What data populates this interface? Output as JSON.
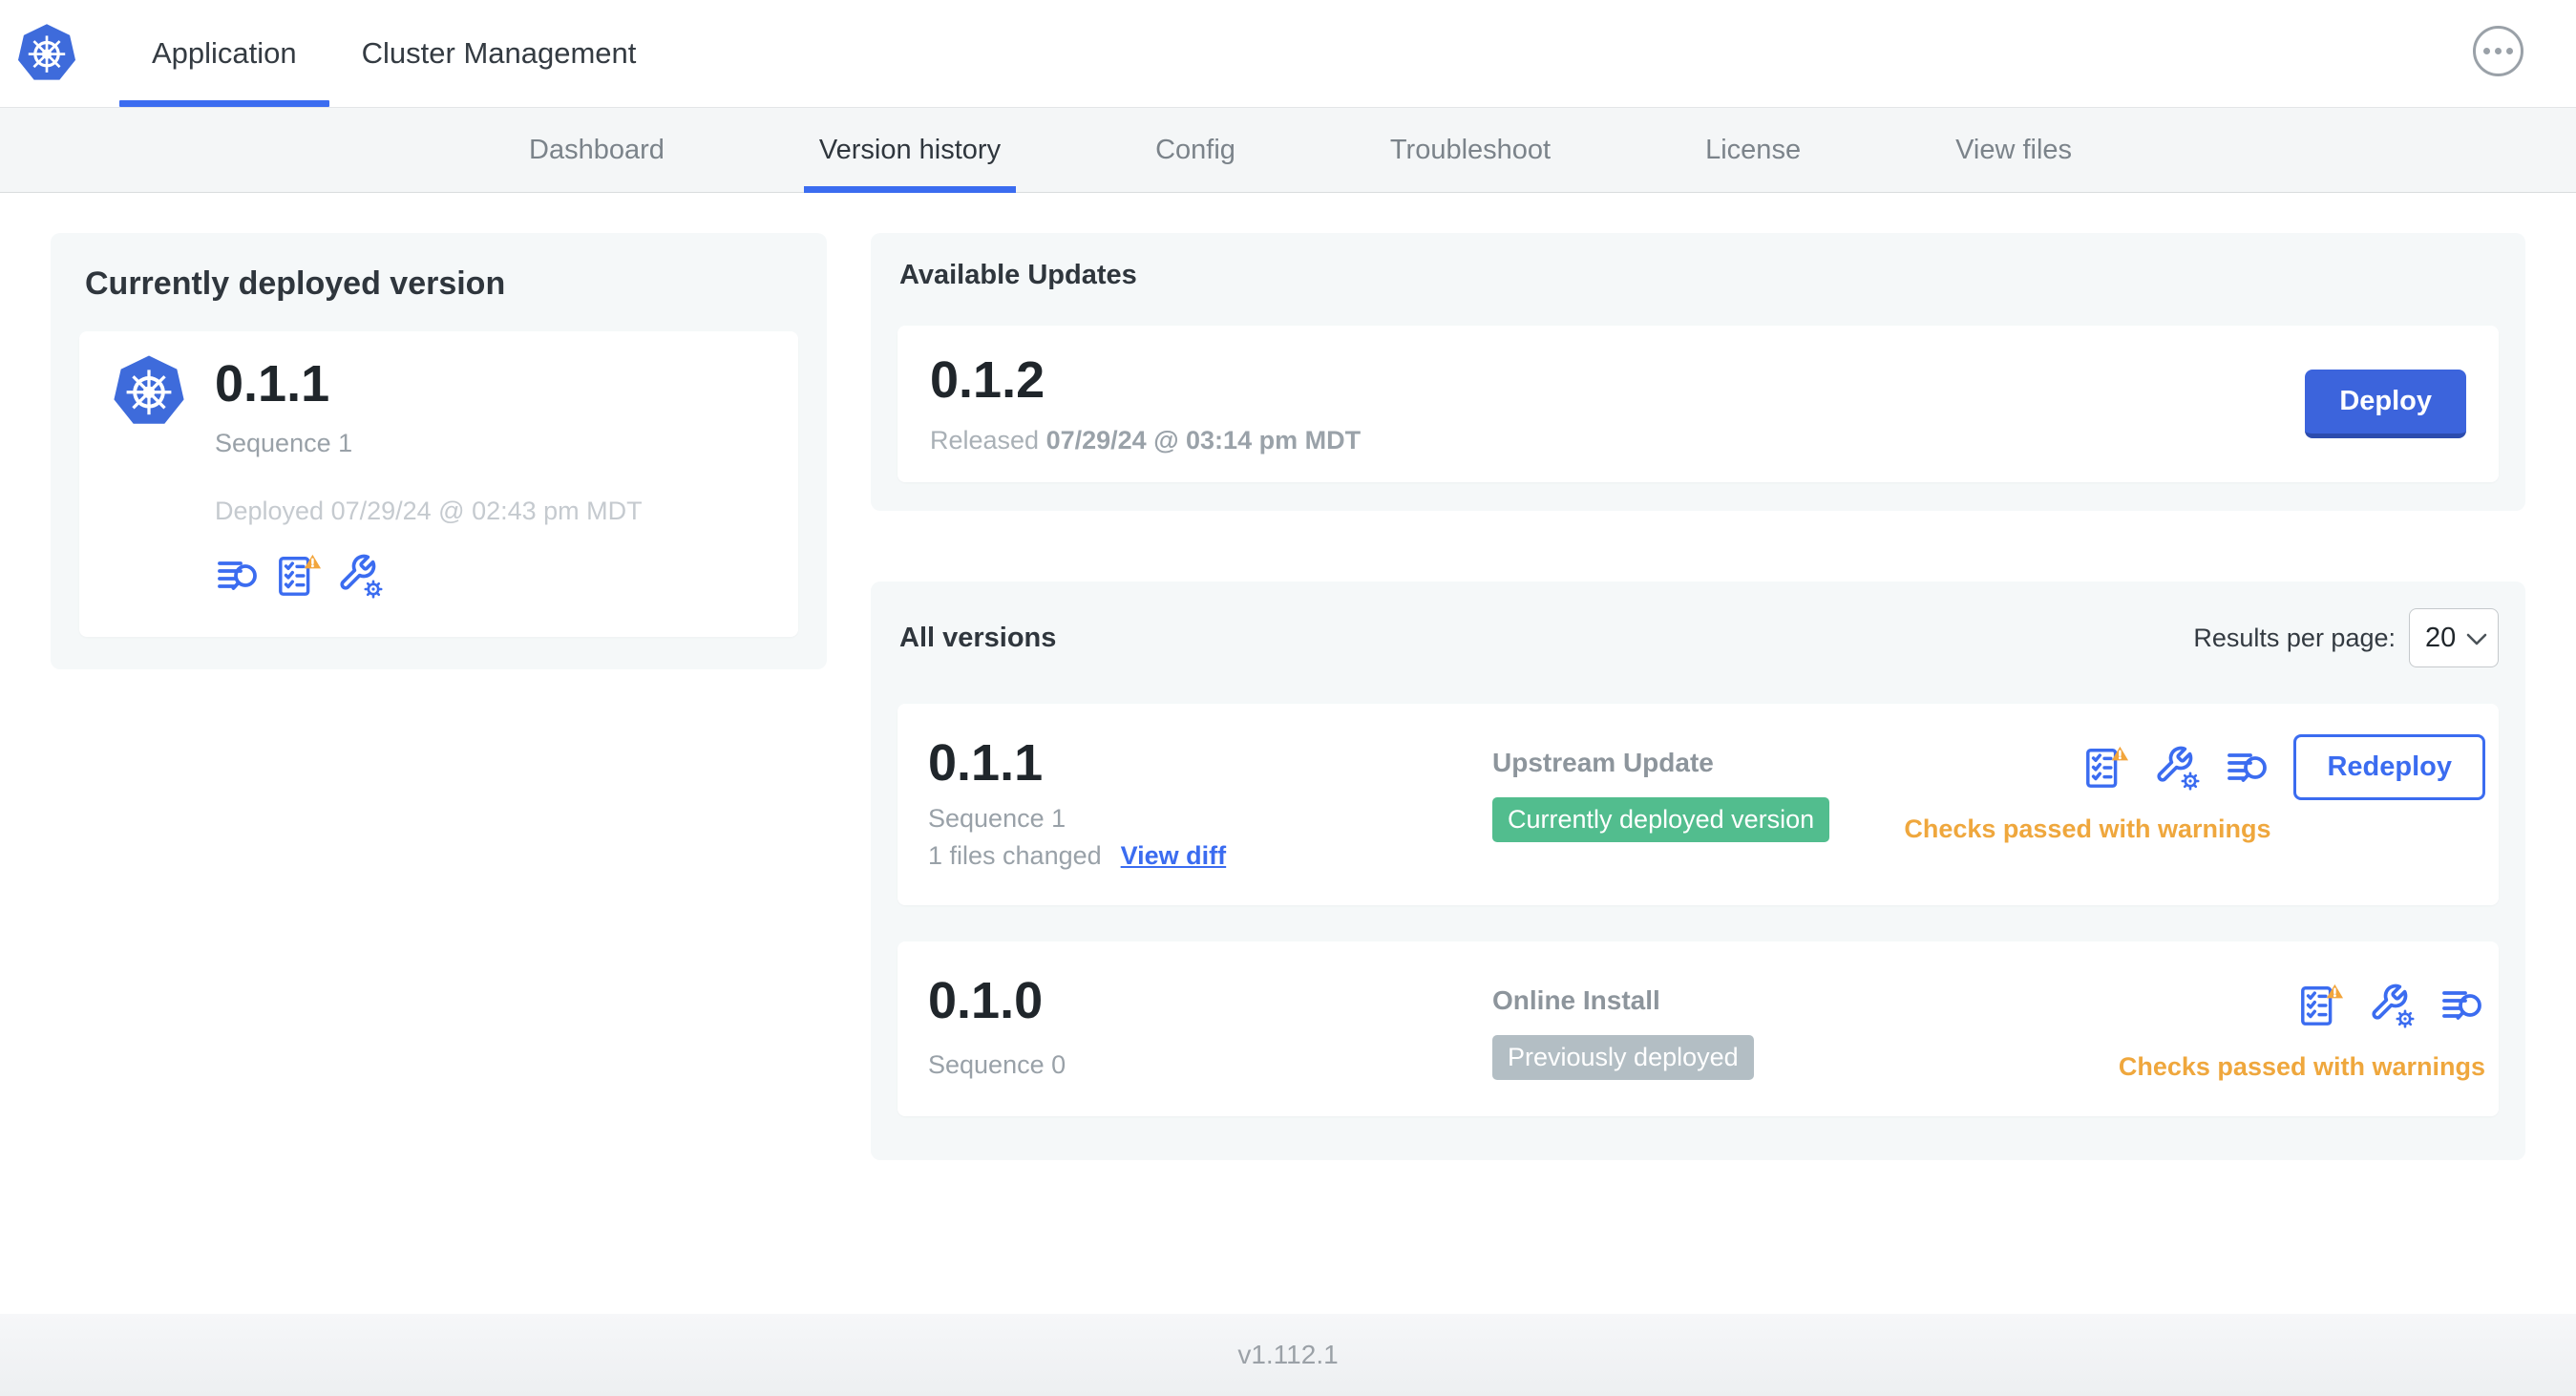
{
  "topnav": {
    "tabs": [
      {
        "label": "Application",
        "active": true
      },
      {
        "label": "Cluster Management",
        "active": false
      }
    ],
    "menu_icon": "ellipsis-menu-icon"
  },
  "subnav": {
    "tabs": [
      {
        "label": "Dashboard",
        "active": false
      },
      {
        "label": "Version history",
        "active": true
      },
      {
        "label": "Config",
        "active": false
      },
      {
        "label": "Troubleshoot",
        "active": false
      },
      {
        "label": "License",
        "active": false
      },
      {
        "label": "View files",
        "active": false
      }
    ]
  },
  "current_version": {
    "title": "Currently deployed version",
    "version": "0.1.1",
    "sequence": "Sequence 1",
    "deployed": "Deployed 07/29/24 @ 02:43 pm MDT",
    "icons": [
      "diff-lines-icon",
      "checklist-warning-icon",
      "wrench-gear-icon"
    ]
  },
  "available_updates": {
    "title": "Available Updates",
    "version": "0.1.2",
    "released_label": "Released",
    "released_datetime": "07/29/24 @ 03:14 pm MDT",
    "deploy_button": "Deploy"
  },
  "all_versions": {
    "title": "All versions",
    "results_per_page_label": "Results per page:",
    "results_per_page_value": "20",
    "rows": [
      {
        "version": "0.1.1",
        "sequence": "Sequence 1",
        "files_changed": "1 files changed",
        "view_diff_link": "View diff",
        "source": "Upstream Update",
        "badge_label": "Currently deployed version",
        "badge_color": "#52bd8e",
        "icons": [
          "checklist-warning-icon",
          "wrench-gear-icon",
          "diff-lines-icon"
        ],
        "action_button": "Redeploy",
        "status_text": "Checks passed with warnings"
      },
      {
        "version": "0.1.0",
        "sequence": "Sequence 0",
        "source": "Online Install",
        "badge_label": "Previously deployed",
        "badge_color": "#b3bec4",
        "icons": [
          "checklist-warning-icon",
          "wrench-gear-icon",
          "diff-lines-icon"
        ],
        "status_text": "Checks passed with warnings"
      }
    ]
  },
  "footer": {
    "app_version": "v1.112.1"
  },
  "colors": {
    "accent_blue": "#3b6cf0",
    "button_blue": "#3c64dc",
    "badge_green": "#52bd8e",
    "badge_gray": "#b3bec4",
    "warning_orange": "#efa73d",
    "panel_bg": "#f5f8f9",
    "subnav_bg": "#f4f6f7"
  }
}
